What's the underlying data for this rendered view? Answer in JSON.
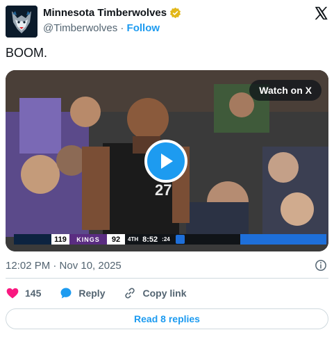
{
  "account": {
    "name": "Minnesota Timberwolves",
    "handle": "@Timberwolves",
    "separator": "·",
    "follow_label": "Follow"
  },
  "tweet": {
    "text": "BOOM.",
    "timestamp": "12:02 PM · Nov 10, 2025"
  },
  "media": {
    "watch_label": "Watch on X",
    "scorebug": {
      "home_score": "119",
      "away_team": "KINGS",
      "away_score": "92",
      "period": "4TH",
      "clock": "8:52",
      "shot_clock": ":24"
    }
  },
  "actions": {
    "like_count": "145",
    "reply_label": "Reply",
    "copy_link_label": "Copy link"
  },
  "read_replies_label": "Read 8 replies",
  "colors": {
    "accent": "#1d9bf0",
    "like": "#f91880",
    "muted": "#536471",
    "text": "#0f1419",
    "verified": "#e2b719"
  }
}
